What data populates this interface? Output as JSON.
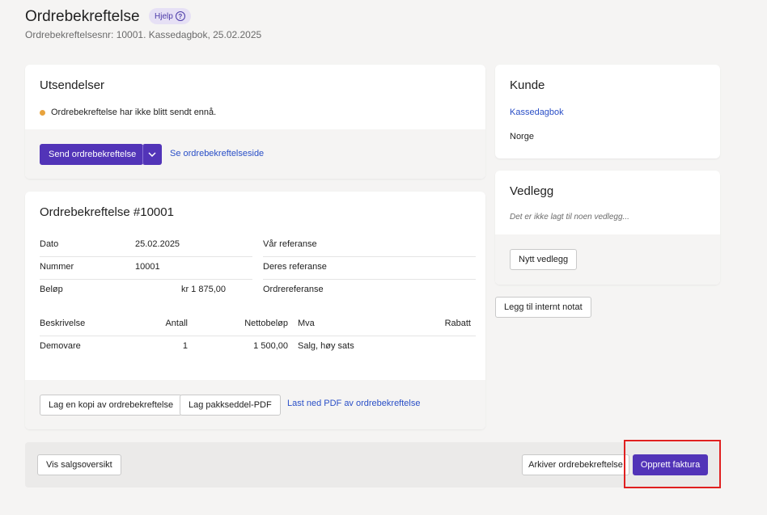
{
  "header": {
    "title": "Ordrebekreftelse",
    "help_label": "Hjelp",
    "subtitle": "Ordrebekreftelsesnr: 10001. Kassedagbok, 25.02.2025"
  },
  "utsendelser": {
    "title": "Utsendelser",
    "status_text": "Ordrebekreftelse har ikke blitt sendt ennå.",
    "status_color": "#e8a33d",
    "send_button_label": "Send ordrebekreftelse",
    "view_link_label": "Se ordrebekreftelseside"
  },
  "order": {
    "title": "Ordrebekreftelse #10001",
    "fields": {
      "dato_label": "Dato",
      "dato_value": "25.02.2025",
      "nummer_label": "Nummer",
      "nummer_value": "10001",
      "belop_label": "Beløp",
      "belop_value": "kr 1 875,00",
      "var_ref_label": "Vår referanse",
      "deres_ref_label": "Deres referanse",
      "ordre_ref_label": "Ordrereferanse"
    },
    "lines_headers": {
      "beskrivelse": "Beskrivelse",
      "antall": "Antall",
      "nettobelop": "Nettobeløp",
      "mva": "Mva",
      "rabatt": "Rabatt"
    },
    "lines": [
      {
        "beskrivelse": "Demovare",
        "antall": "1",
        "nettobelop": "1 500,00",
        "mva": "Salg, høy sats",
        "rabatt": ""
      }
    ],
    "copy_button_label": "Lag en kopi av ordrebekreftelse",
    "packslip_button_label": "Lag pakkseddel-PDF",
    "download_link_label": "Last ned PDF av ordrebekreftelse"
  },
  "kunde": {
    "title": "Kunde",
    "name": "Kassedagbok",
    "country": "Norge"
  },
  "vedlegg": {
    "title": "Vedlegg",
    "empty_text": "Det er ikke lagt til noen vedlegg...",
    "new_button_label": "Nytt vedlegg"
  },
  "internal_note_button_label": "Legg til internt notat",
  "footer": {
    "sales_overview_label": "Vis salgsoversikt",
    "archive_label": "Arkiver ordrebekreftelse",
    "create_invoice_label": "Opprett faktura"
  },
  "colors": {
    "primary": "#5234b8",
    "link": "#2a4fc7",
    "highlight": "#e02020"
  }
}
